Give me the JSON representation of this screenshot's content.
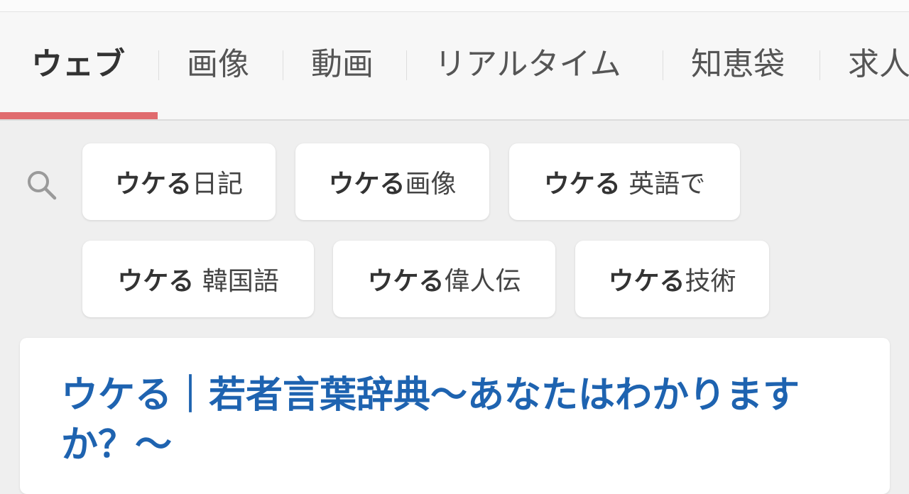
{
  "tabs": [
    {
      "label": "ウェブ",
      "active": true
    },
    {
      "label": "画像",
      "active": false
    },
    {
      "label": "動画",
      "active": false
    },
    {
      "label": "リアルタイム",
      "active": false
    },
    {
      "label": "知恵袋",
      "active": false
    },
    {
      "label": "求人",
      "active": false
    }
  ],
  "colors": {
    "accent": "#e06b6e",
    "link": "#1e63b0"
  },
  "search_icon": "search-icon",
  "suggestions": [
    {
      "query": "ウケる",
      "suffix": "日記"
    },
    {
      "query": "ウケる",
      "suffix": "画像"
    },
    {
      "query": "ウケる",
      "suffix": " 英語で"
    },
    {
      "query": "ウケる",
      "suffix": " 韓国語"
    },
    {
      "query": "ウケる",
      "suffix": "偉人伝"
    },
    {
      "query": "ウケる",
      "suffix": "技術"
    }
  ],
  "result": {
    "title": "ウケる｜若者言葉辞典〜あなたはわかりますか？〜"
  }
}
